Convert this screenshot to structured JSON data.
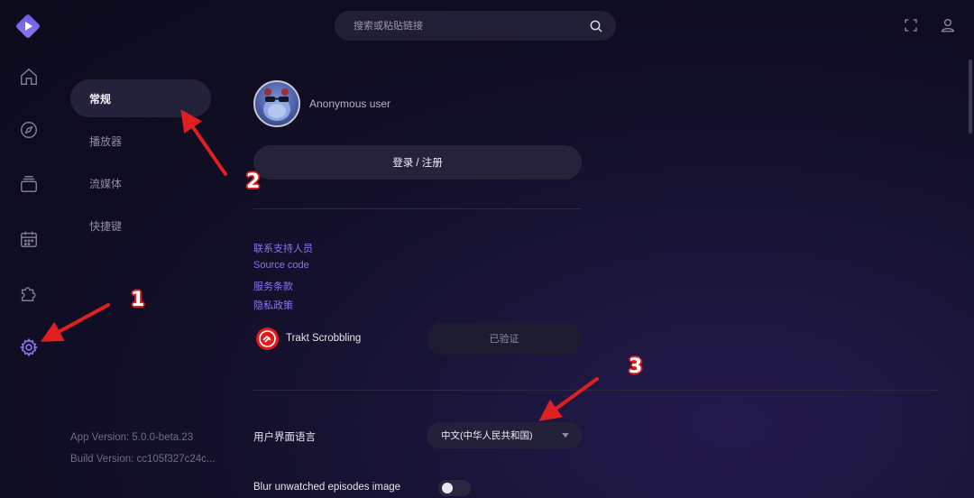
{
  "search": {
    "placeholder": "搜索或粘贴链接"
  },
  "nav": {
    "items": [
      {
        "label": "常规",
        "active": true
      },
      {
        "label": "播放器",
        "active": false
      },
      {
        "label": "流媒体",
        "active": false
      },
      {
        "label": "快捷键",
        "active": false
      }
    ]
  },
  "app_version": "App Version: 5.0.0-beta.23",
  "build_version": "Build Version: cc105f327c24c...",
  "profile": {
    "username": "Anonymous user",
    "login_label": "登录 / 注册"
  },
  "links": [
    "联系支持人员",
    "Source code",
    "服务条款",
    "隐私政策"
  ],
  "trakt": {
    "label": "Trakt Scrobbling",
    "status_label": "已验证"
  },
  "language": {
    "label": "用户界面语言",
    "selected": "中文(中华人民共和国)"
  },
  "blur_episodes": {
    "label": "Blur unwatched episodes image",
    "enabled": false
  },
  "annotations": [
    "1",
    "2",
    "3"
  ],
  "colors": {
    "accent": "#8a74f0",
    "annotation": "#e02020",
    "background": "#0f0d22"
  },
  "icons": [
    "logo-icon",
    "home-icon",
    "compass-icon",
    "library-icon",
    "calendar-icon",
    "puzzle-icon",
    "gear-icon",
    "search-icon",
    "fullscreen-icon",
    "user-icon",
    "chevron-down-icon",
    "trakt-icon"
  ]
}
